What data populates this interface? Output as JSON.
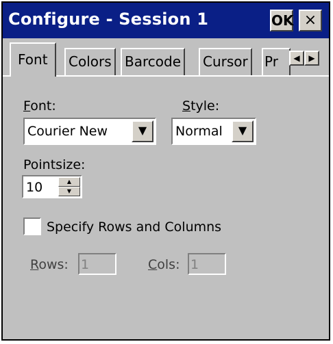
{
  "window": {
    "title": "Configure - Session 1",
    "ok_label": "OK",
    "close_label": "×"
  },
  "tabs": [
    {
      "label": "Font",
      "active": true
    },
    {
      "label": "Colors"
    },
    {
      "label": "Barcode"
    },
    {
      "label": "Cursor"
    },
    {
      "label": "Pr"
    }
  ],
  "tab_scroll": {
    "left_icon": "◀",
    "right_icon": "▶"
  },
  "font": {
    "label_prefix": "F",
    "label_rest": "ont:",
    "value": "Courier New",
    "dropdown_icon": "▼"
  },
  "style": {
    "label_prefix": "S",
    "label_rest": "tyle:",
    "value": "Normal",
    "dropdown_icon": "▼"
  },
  "pointsize": {
    "label": "Pointsize:",
    "value": "10",
    "up_icon": "▲",
    "down_icon": "▼"
  },
  "rows_cols": {
    "checkbox_label": "Specify Rows and Columns",
    "checked": false,
    "rows_label_prefix": "R",
    "rows_label_rest": "ows:",
    "rows_value": "1",
    "cols_label_prefix": "C",
    "cols_label_rest": "ols:",
    "cols_value": "1"
  }
}
